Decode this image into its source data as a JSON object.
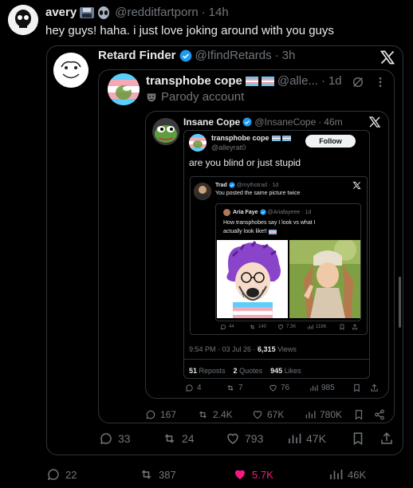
{
  "outer": {
    "author_name": "avery",
    "handle": "@redditfartporn",
    "time": "14h",
    "text": "hey guys! haha. i just love joking around with you guys",
    "stats": {
      "replies": "22",
      "reposts": "387",
      "likes": "5.7K",
      "views": "46K"
    }
  },
  "q1": {
    "author_name": "Retard Finder",
    "handle": "@IfindRetards",
    "time": "3h",
    "stats": {
      "replies": "33",
      "reposts": "24",
      "likes": "793",
      "views": "47K"
    }
  },
  "q2": {
    "author_name": "transphobe cope",
    "handle": "@alle...",
    "time": "1d",
    "label": "Parody account",
    "stats": {
      "replies": "167",
      "reposts": "2.4K",
      "likes": "67K",
      "views": "780K"
    }
  },
  "q3": {
    "author_name": "Insane Cope",
    "handle": "@InsaneCope",
    "time": "46m",
    "stats": {
      "replies": "4",
      "reposts": "7",
      "likes": "76",
      "views": "985"
    }
  },
  "q4": {
    "author_name": "transphobe cope",
    "handle": "@alleyrat0",
    "follow_label": "Follow",
    "text": "are you blind or just stupid",
    "timestamp": "9:54 PM · 03 Jul 26 · ",
    "views_count": "6,315",
    "views_label": " Views",
    "reposts_count": "51",
    "reposts_label": " Reposts",
    "quotes_count": "2",
    "quotes_label": " Quotes",
    "likes_count": "945",
    "likes_label": " Likes"
  },
  "q5": {
    "author_name": "Trad",
    "handle": "@mythotrad",
    "time": "1d",
    "text": "You posted the same picture twice",
    "stats": {
      "replies": "44",
      "reposts": "140",
      "likes": "7.3K",
      "views": "118K"
    }
  },
  "q6": {
    "author_name": "Aria Faye",
    "handle": "@Ariafayeee",
    "time": "1d",
    "text_line1": "How transphobes say I look vs what I",
    "text_line2": "actually look like!!"
  },
  "colors": {
    "accent": "#1d9bf0",
    "like_active": "#f91880",
    "border": "#2f3336",
    "muted": "#71767b"
  }
}
